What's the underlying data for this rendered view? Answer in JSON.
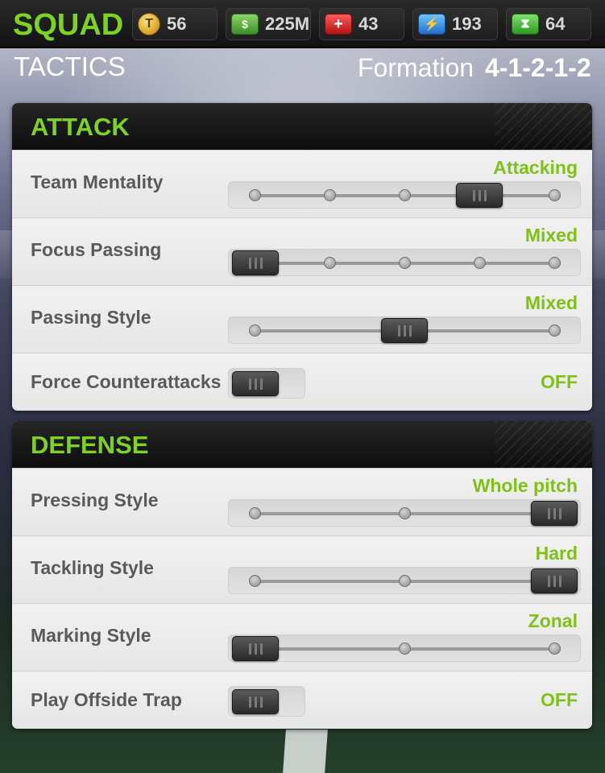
{
  "header": {
    "title": "SQUAD",
    "resources": [
      {
        "icon": "coin-icon",
        "glyph": "T",
        "value": "56"
      },
      {
        "icon": "cash-icon",
        "glyph": "$",
        "value": "225M"
      },
      {
        "icon": "medical-icon",
        "glyph": "+",
        "value": "43"
      },
      {
        "icon": "energy-icon",
        "glyph": "⚡",
        "value": "193"
      },
      {
        "icon": "hourglass-icon",
        "glyph": "⧗",
        "value": "64"
      }
    ]
  },
  "subheader": {
    "section": "TACTICS",
    "formation_label": "Formation",
    "formation_value": "4-1-2-1-2"
  },
  "attack": {
    "title": "ATTACK",
    "rows": [
      {
        "label": "Team Mentality",
        "value": "Attacking",
        "type": "slider",
        "stops": 5,
        "selected": 3
      },
      {
        "label": "Focus Passing",
        "value": "Mixed",
        "type": "slider",
        "stops": 5,
        "selected": 0
      },
      {
        "label": "Passing Style",
        "value": "Mixed",
        "type": "slider",
        "stops": 3,
        "selected": 1
      },
      {
        "label": "Force Counterattacks",
        "value": "OFF",
        "type": "toggle"
      }
    ]
  },
  "defense": {
    "title": "DEFENSE",
    "rows": [
      {
        "label": "Pressing Style",
        "value": "Whole pitch",
        "type": "slider",
        "stops": 3,
        "selected": 2
      },
      {
        "label": "Tackling Style",
        "value": "Hard",
        "type": "slider",
        "stops": 3,
        "selected": 2
      },
      {
        "label": "Marking Style",
        "value": "Zonal",
        "type": "slider",
        "stops": 3,
        "selected": 0
      },
      {
        "label": "Play Offside Trap",
        "value": "OFF",
        "type": "toggle"
      }
    ]
  },
  "colors": {
    "accent": "#7ed321",
    "value_text": "#7ec217",
    "label_text": "#5a5a5a"
  }
}
